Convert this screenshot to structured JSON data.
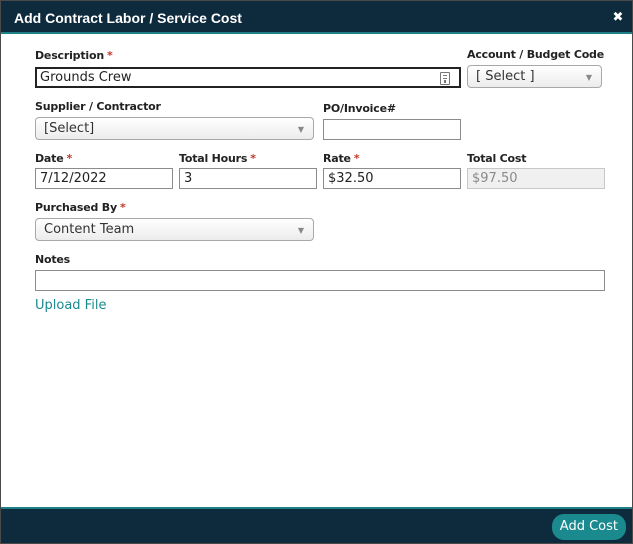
{
  "dialog": {
    "title": "Add Contract Labor / Service Cost",
    "close_glyph": "✖"
  },
  "form": {
    "description": {
      "label": "Description",
      "required_mark": "*",
      "value": "Grounds Crew"
    },
    "account_budget_code": {
      "label": "Account / Budget Code",
      "selected": "[ Select ]"
    },
    "supplier": {
      "label": "Supplier / Contractor",
      "selected": "[Select]"
    },
    "po_invoice": {
      "label": "PO/Invoice#",
      "value": ""
    },
    "date": {
      "label": "Date",
      "required_mark": "*",
      "value": "7/12/2022"
    },
    "total_hours": {
      "label": "Total Hours",
      "required_mark": "*",
      "value": "3"
    },
    "rate": {
      "label": "Rate",
      "required_mark": "*",
      "value": "$32.50"
    },
    "total_cost": {
      "label": "Total Cost",
      "value": "$97.50"
    },
    "purchased_by": {
      "label": "Purchased By",
      "required_mark": "*",
      "selected": "Content Team"
    },
    "notes": {
      "label": "Notes",
      "value": ""
    },
    "upload_link": "Upload File"
  },
  "footer": {
    "add_button": "Add Cost"
  },
  "colors": {
    "header_bg": "#0e2a3d",
    "accent": "#1a8a8f",
    "required": "#c0392b"
  },
  "icons": {
    "close": "close-icon",
    "description_field": "contact-card-icon",
    "dropdown": "chevron-down-icon"
  }
}
